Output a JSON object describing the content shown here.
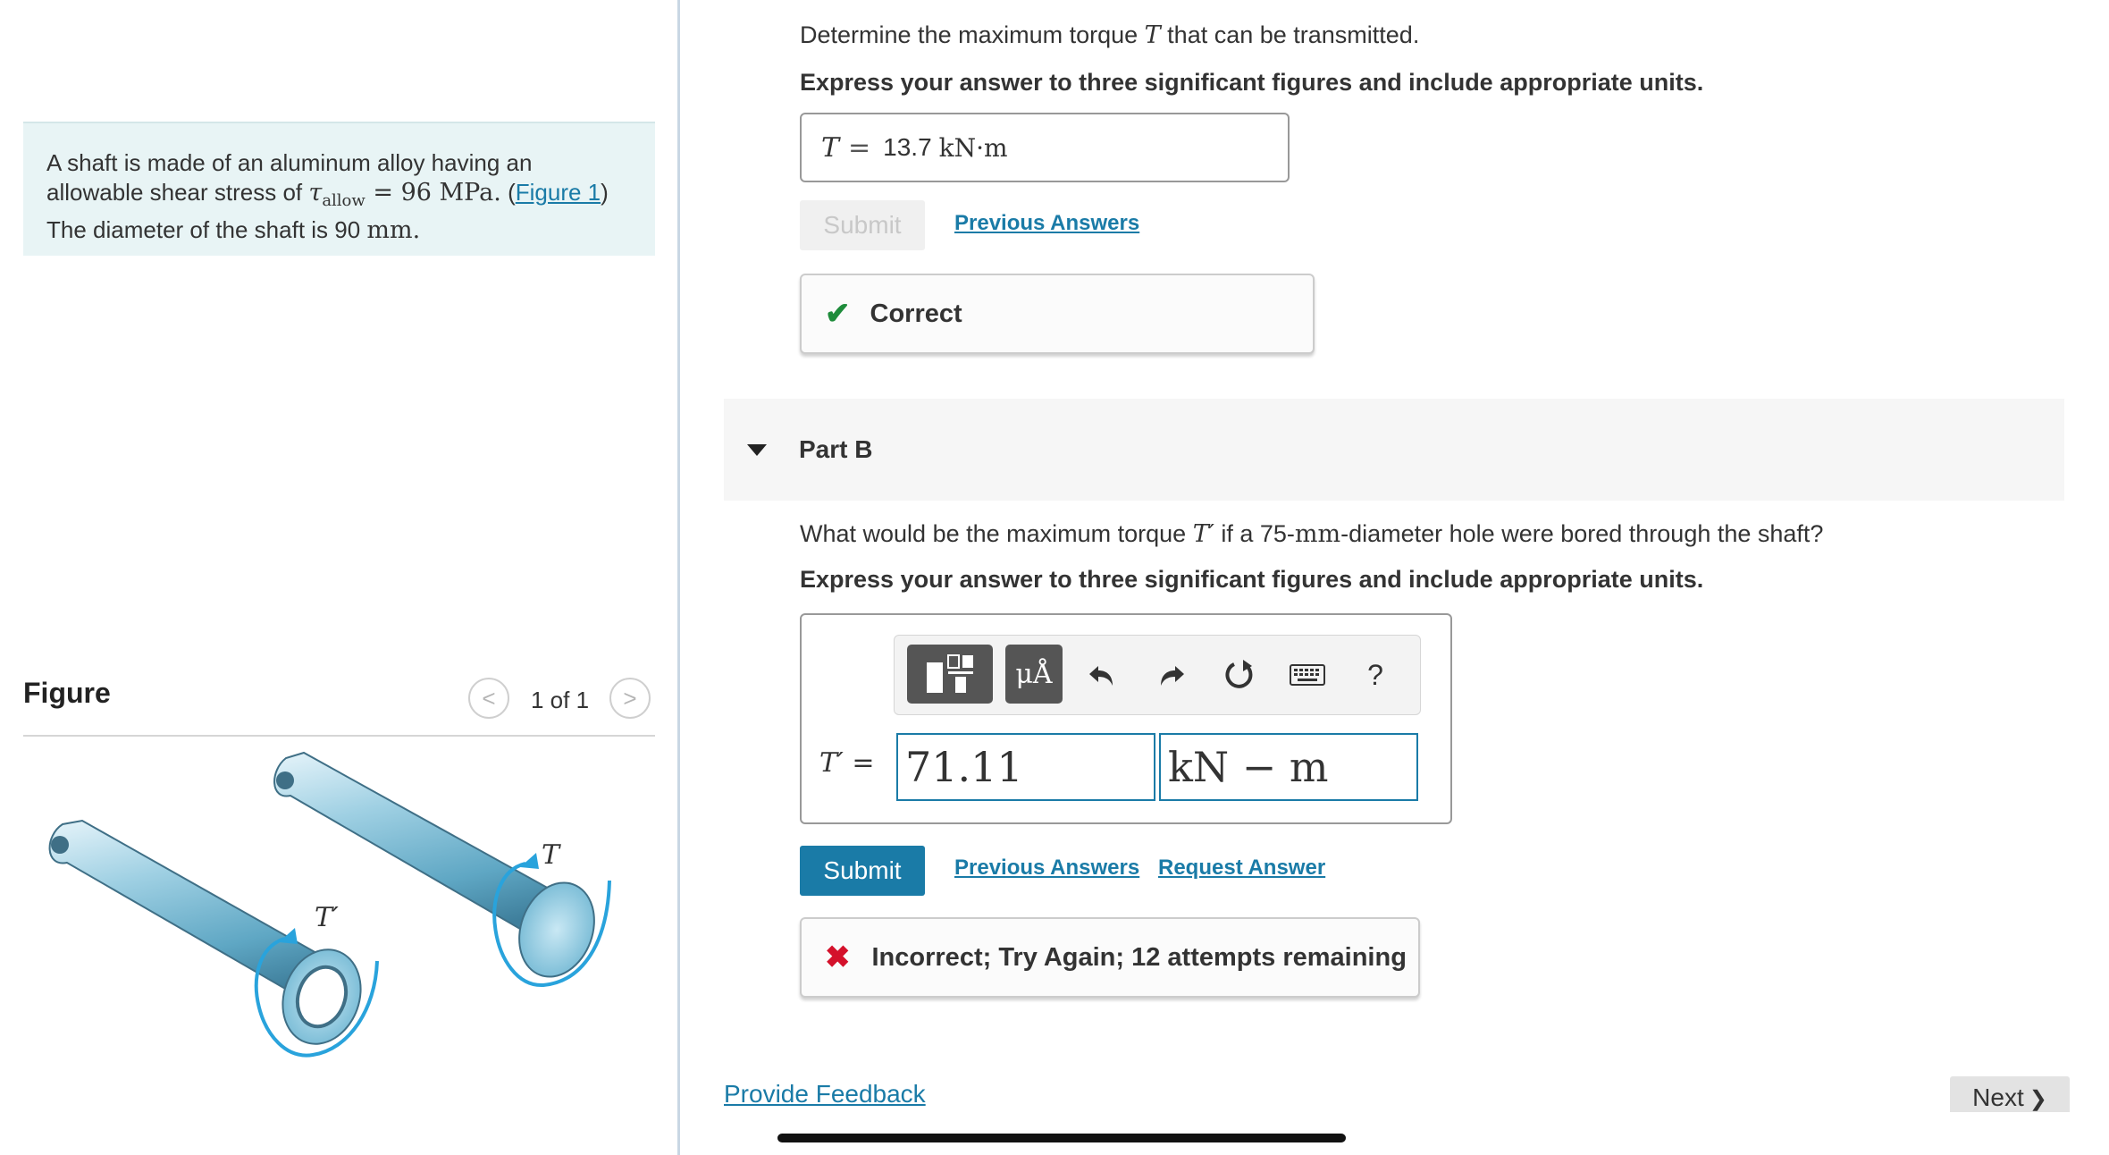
{
  "problem": {
    "line1": "A shaft is made of an aluminum alloy having an",
    "line2_prefix": "allowable shear stress of ",
    "tau_symbol": "τ",
    "tau_subscript": "allow",
    "equals_value": " = 96 MPa",
    "period": ".",
    "figure_link": "Figure 1",
    "line3_prefix": "The diameter of the shaft is 90 ",
    "line3_unit": "mm",
    "line3_suffix": "."
  },
  "figure": {
    "title": "Figure",
    "counter": "1 of 1",
    "prev_glyph": "<",
    "next_glyph": ">",
    "label_T": "T",
    "label_T_prime": "T′"
  },
  "partA": {
    "question_prefix": "Determine the maximum torque ",
    "question_var": "T",
    "question_suffix": " that can be transmitted.",
    "instruction": "Express your answer to three significant figures and include appropriate units.",
    "answer_var": "T",
    "answer_eq": "=",
    "answer_value": "13.7",
    "answer_units": "kN·m",
    "submit_label": "Submit",
    "previous_answers": "Previous Answers",
    "feedback_glyph": "✔",
    "feedback_text": "Correct"
  },
  "partB": {
    "title": "Part B",
    "question_prefix": "What would be the maximum torque ",
    "question_var": "T′",
    "question_mid": " if a 75-",
    "question_unit": "mm",
    "question_suffix": "-diameter hole were bored through the shaft?",
    "instruction": "Express your answer to three significant figures and include appropriate units.",
    "toolbar": {
      "symbols_label": "μÅ",
      "help_label": "?"
    },
    "label_var": "T′",
    "label_eq": " =",
    "value": "71.11",
    "units": "kN − m",
    "submit_label": "Submit",
    "previous_answers": "Previous Answers",
    "request_answer": "Request Answer",
    "feedback_glyph": "✖",
    "feedback_text": "Incorrect; Try Again; 12 attempts remaining"
  },
  "footer": {
    "provide_feedback": "Provide Feedback",
    "next_label": "Next",
    "next_glyph": "❯"
  },
  "colors": {
    "link": "#1a7ba7",
    "correct": "#1e8c3b",
    "incorrect": "#d4112b",
    "problem_bg": "#e8f4f5",
    "shaft": "#8cc4d9",
    "torque_arrow": "#29a3dc"
  }
}
